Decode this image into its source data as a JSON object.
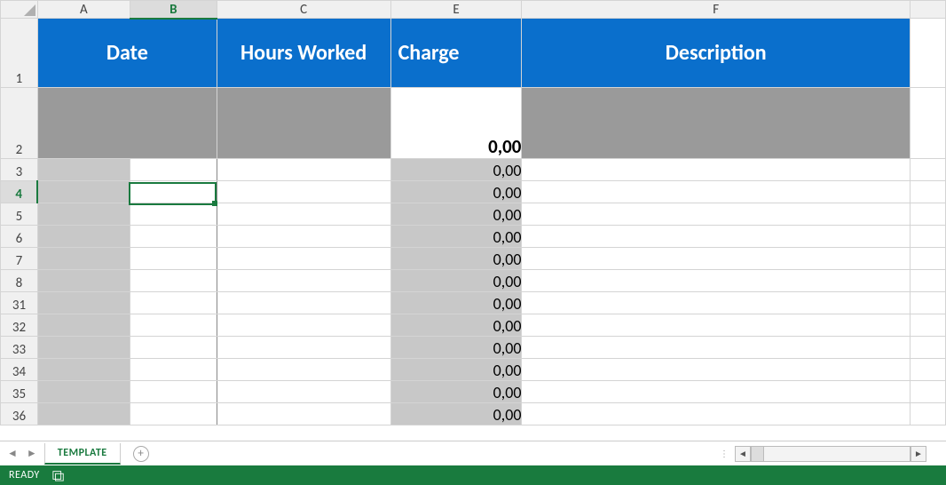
{
  "columns": [
    "A",
    "B",
    "C",
    "E",
    "F"
  ],
  "active_column": "B",
  "row_labels": [
    "1",
    "2",
    "3",
    "4",
    "5",
    "6",
    "7",
    "8",
    "31",
    "32",
    "33",
    "34",
    "35",
    "36"
  ],
  "active_row": "4",
  "headers": {
    "date": "Date",
    "hours": "Hours Worked",
    "charge": "Charge",
    "description": "Description"
  },
  "total_charge": "0,00",
  "rows": [
    {
      "charge": "0,00"
    },
    {
      "charge": "0,00"
    },
    {
      "charge": "0,00"
    },
    {
      "charge": "0,00"
    },
    {
      "charge": "0,00"
    },
    {
      "charge": "0,00"
    },
    {
      "charge": "0,00"
    },
    {
      "charge": "0,00"
    },
    {
      "charge": "0,00"
    },
    {
      "charge": "0,00"
    },
    {
      "charge": "0,00"
    },
    {
      "charge": "0,00"
    }
  ],
  "sheet_tab": "TEMPLATE",
  "status": "READY"
}
